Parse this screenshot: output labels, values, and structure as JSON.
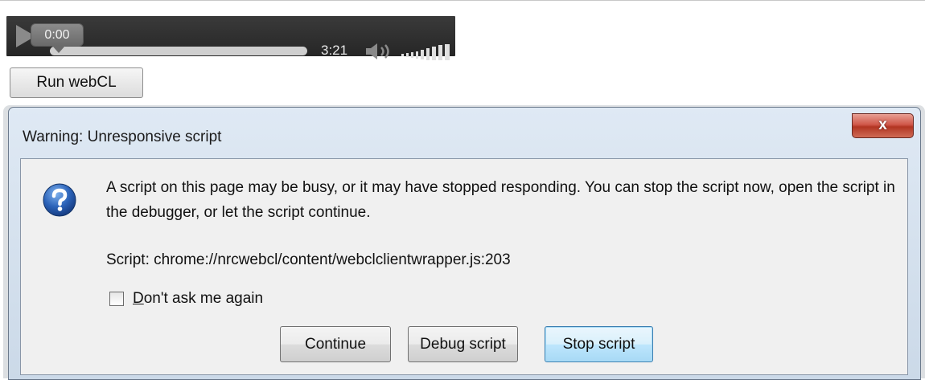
{
  "player": {
    "current_time": "0:00",
    "duration": "3:21",
    "progress": 0
  },
  "run_button": {
    "label": "Run webCL"
  },
  "dialog": {
    "title": "Warning: Unresponsive script",
    "close_glyph": "x",
    "message": "A script on this page may be busy, or it may have stopped responding. You can stop the script now, open the script in the debugger, or let the script continue.",
    "script_line": "Script: chrome://nrcwebcl/content/webclclientwrapper.js:203",
    "checkbox": {
      "mnemonic": "D",
      "label_rest": "on't ask me again",
      "checked": false
    },
    "buttons": {
      "continue": "Continue",
      "debug": "Debug script",
      "stop": "Stop script"
    }
  },
  "icons": {
    "play": "play-icon",
    "volume": "speaker-icon",
    "volume_level": "volume-bars-icon",
    "question": "question-icon",
    "close": "close-icon"
  },
  "colors": {
    "player_bg": "#2f2f2f",
    "dialog_frame": "#cbd9e8",
    "close_button": "#c0432f",
    "question_icon": "#2b62b8",
    "default_button_border": "#3c7fb1"
  }
}
